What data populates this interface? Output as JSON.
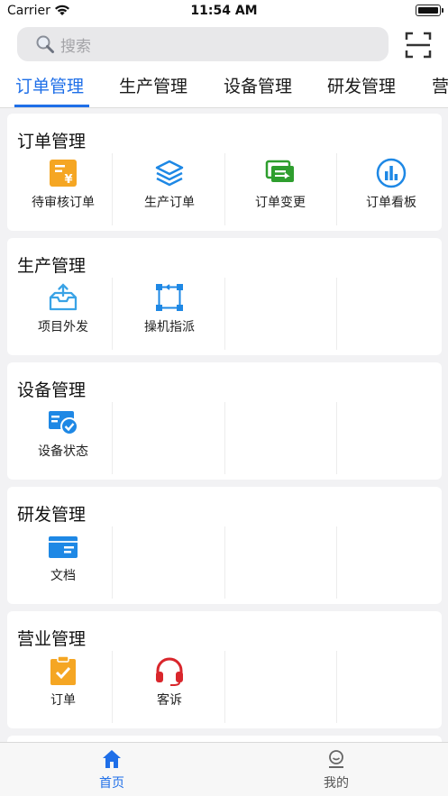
{
  "status": {
    "carrier": "Carrier",
    "time": "11:54 AM"
  },
  "search": {
    "placeholder": "搜索"
  },
  "tabs": [
    "订单管理",
    "生产管理",
    "设备管理",
    "研发管理",
    "营"
  ],
  "colors": {
    "accent": "#1f6fe8",
    "orange": "#f5a623",
    "blue": "#1e88e5",
    "green": "#2e9e2e",
    "red": "#d9262c"
  },
  "sections": [
    {
      "title": "订单管理",
      "items": [
        {
          "label": "待审核订单",
          "icon": "pending-order-icon"
        },
        {
          "label": "生产订单",
          "icon": "layers-icon"
        },
        {
          "label": "订单变更",
          "icon": "order-change-icon"
        },
        {
          "label": "订单看板",
          "icon": "chart-board-icon"
        }
      ]
    },
    {
      "title": "生产管理",
      "items": [
        {
          "label": "项目外发",
          "icon": "outbox-icon"
        },
        {
          "label": "操机指派",
          "icon": "assign-icon"
        }
      ]
    },
    {
      "title": "设备管理",
      "items": [
        {
          "label": "设备状态",
          "icon": "device-status-icon"
        }
      ]
    },
    {
      "title": "研发管理",
      "items": [
        {
          "label": "文档",
          "icon": "document-icon"
        }
      ]
    },
    {
      "title": "营业管理",
      "items": [
        {
          "label": "订单",
          "icon": "clipboard-check-icon"
        },
        {
          "label": "客诉",
          "icon": "headset-icon"
        }
      ]
    }
  ],
  "bottom_nav": [
    {
      "label": "首页",
      "icon": "home-icon"
    },
    {
      "label": "我的",
      "icon": "profile-icon"
    }
  ]
}
